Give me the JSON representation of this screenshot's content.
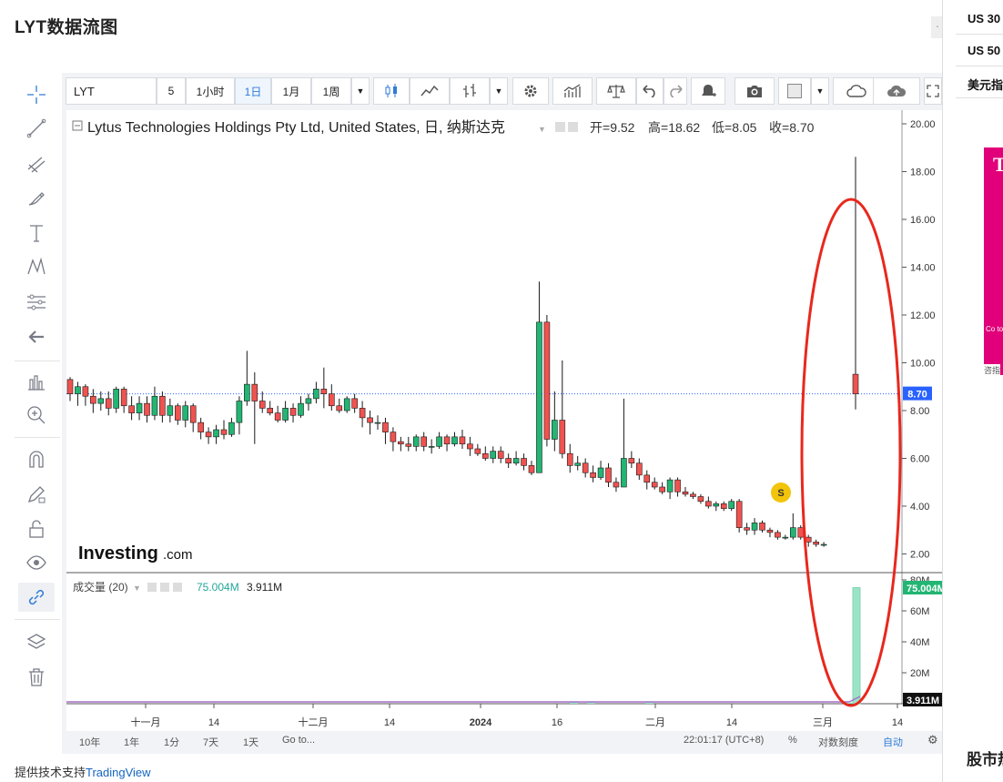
{
  "page": {
    "title": "LYT数据流图",
    "credit_prefix": "提供技术支持",
    "credit_link": "TradingView"
  },
  "right_panel": {
    "items": [
      "US 30",
      "US 50",
      "美元指"
    ],
    "ad_letter": "T",
    "ad_text": "Co to c cre am",
    "ad_tag": "咨指",
    "footer": "股市热"
  },
  "toolbar": {
    "symbol": "LYT",
    "intervals": [
      "5",
      "1小时",
      "1日",
      "1月",
      "1周"
    ],
    "active_interval": "1日",
    "icons": [
      "candles-icon",
      "area-chart-icon",
      "bars-icon",
      "settings-icon",
      "indicators-icon",
      "compare-icon",
      "undo-icon",
      "redo-icon",
      "alert-icon",
      "camera-icon",
      "color-swatch-icon",
      "cloud-icon",
      "cloud-upload-icon",
      "fullscreen-icon"
    ]
  },
  "left_tools": [
    "crosshair-icon",
    "trendline-icon",
    "pitchfork-icon",
    "brush-icon",
    "text-icon",
    "pattern-icon",
    "fib-icon",
    "back-arrow-icon",
    "measure-icon",
    "zoom-icon",
    "magnet-icon",
    "pencil-lock-icon",
    "unlock-icon",
    "eye-icon",
    "link-icon",
    "layers-icon",
    "trash-icon"
  ],
  "chart": {
    "legend_title": "Lytus Technologies Holdings Pty Ltd, United States, 日, 纳斯达克",
    "ohlc": {
      "open_label": "开=",
      "open": "9.52",
      "high_label": "高=",
      "high": "18.62",
      "low_label": "低=",
      "low": "8.05",
      "close_label": "收=",
      "close": "8.70"
    },
    "watermark": "Investing",
    "watermark_suffix": ".com",
    "last_price_label": "8.70",
    "event_marker": "S",
    "volume_legend": "成交量 (20)",
    "volume_value_1": "75.004M",
    "volume_value_2": "3.911M",
    "volume_last_label": "75.004M",
    "volume_ma_label": "3.911M",
    "timestamp": "22:01:17 (UTC+8)"
  },
  "bottom_bar": {
    "ranges": [
      "10年",
      "1年",
      "1分",
      "7天",
      "1天",
      "Go to..."
    ],
    "percent": "%",
    "log_scale": "对数刻度",
    "auto": "自动"
  },
  "chart_data": {
    "type": "candlestick",
    "price_axis": {
      "ticks": [
        "20.00",
        "18.00",
        "16.00",
        "14.00",
        "12.00",
        "10.00",
        "8.00",
        "6.00",
        "4.00",
        "2.00"
      ],
      "ylim": [
        0.7,
        20.8
      ]
    },
    "volume_axis": {
      "ticks": [
        "80M",
        "60M",
        "40M",
        "20M"
      ],
      "ylim": [
        0,
        80
      ]
    },
    "x_tick_labels": [
      "十一月",
      "14",
      "十二月",
      "14",
      "2024",
      "16",
      "二月",
      "14",
      "三月",
      "14"
    ],
    "colors": {
      "up": "#26a69a",
      "up_fill": "#22b573",
      "down": "#ef5350",
      "up_volume": "#9be3c6",
      "down_volume": "#f7b3b1",
      "annotation": "#e8281d"
    },
    "annotation": "red-ellipse-around-last-spike",
    "candles": [
      [
        9.3,
        8.7,
        9.4,
        8.4
      ],
      [
        8.7,
        9.0,
        9.2,
        8.2
      ],
      [
        9.0,
        8.6,
        9.1,
        8.2
      ],
      [
        8.6,
        8.3,
        8.9,
        7.9
      ],
      [
        8.3,
        8.5,
        8.8,
        8.0
      ],
      [
        8.5,
        8.1,
        8.8,
        7.8
      ],
      [
        8.1,
        8.9,
        9.0,
        7.9
      ],
      [
        8.9,
        8.2,
        9.0,
        7.9
      ],
      [
        8.2,
        7.9,
        8.6,
        7.6
      ],
      [
        7.9,
        8.3,
        8.6,
        7.6
      ],
      [
        8.3,
        7.8,
        8.6,
        7.5
      ],
      [
        7.8,
        8.6,
        9.0,
        7.6
      ],
      [
        8.6,
        7.8,
        8.8,
        7.5
      ],
      [
        7.8,
        8.2,
        8.5,
        7.5
      ],
      [
        8.2,
        7.6,
        8.3,
        7.4
      ],
      [
        7.6,
        8.2,
        8.4,
        7.3
      ],
      [
        8.2,
        7.5,
        8.3,
        7.1
      ],
      [
        7.5,
        7.1,
        7.7,
        6.8
      ],
      [
        7.1,
        6.9,
        7.3,
        6.6
      ],
      [
        6.9,
        7.2,
        7.4,
        6.6
      ],
      [
        7.2,
        7.0,
        7.6,
        6.8
      ],
      [
        7.0,
        7.5,
        7.7,
        6.9
      ],
      [
        7.5,
        8.4,
        8.6,
        7.0
      ],
      [
        8.4,
        9.1,
        10.5,
        8.2
      ],
      [
        9.1,
        8.4,
        9.6,
        6.6
      ],
      [
        8.4,
        8.1,
        8.8,
        7.9
      ],
      [
        8.1,
        7.9,
        8.4,
        7.8
      ],
      [
        7.9,
        7.6,
        8.2,
        7.5
      ],
      [
        7.6,
        8.1,
        8.4,
        7.5
      ],
      [
        8.1,
        7.8,
        8.3,
        7.5
      ],
      [
        7.8,
        8.3,
        8.6,
        7.7
      ],
      [
        8.3,
        8.5,
        8.7,
        8.0
      ],
      [
        8.5,
        8.9,
        9.2,
        8.3
      ],
      [
        8.9,
        8.7,
        9.8,
        8.1
      ],
      [
        8.7,
        8.2,
        9.1,
        8.0
      ],
      [
        8.2,
        8.0,
        8.5,
        7.9
      ],
      [
        8.0,
        8.5,
        8.6,
        7.9
      ],
      [
        8.5,
        8.1,
        8.7,
        7.9
      ],
      [
        8.1,
        7.7,
        8.4,
        7.3
      ],
      [
        7.7,
        7.5,
        8.0,
        7.0
      ],
      [
        7.5,
        7.5,
        7.8,
        7.2
      ],
      [
        7.5,
        7.1,
        7.7,
        6.6
      ],
      [
        7.1,
        6.7,
        7.3,
        6.3
      ],
      [
        6.7,
        6.6,
        6.9,
        6.3
      ],
      [
        6.6,
        6.5,
        6.9,
        6.3
      ],
      [
        6.5,
        6.9,
        7.0,
        6.3
      ],
      [
        6.9,
        6.5,
        7.1,
        6.3
      ],
      [
        6.5,
        6.5,
        6.8,
        6.2
      ],
      [
        6.5,
        6.9,
        7.1,
        6.4
      ],
      [
        6.9,
        6.6,
        7.0,
        6.3
      ],
      [
        6.6,
        6.9,
        7.1,
        6.5
      ],
      [
        6.9,
        6.6,
        7.2,
        6.4
      ],
      [
        6.6,
        6.4,
        6.9,
        6.1
      ],
      [
        6.4,
        6.2,
        6.6,
        6.1
      ],
      [
        6.2,
        6.0,
        6.5,
        5.9
      ],
      [
        6.0,
        6.3,
        6.5,
        5.8
      ],
      [
        6.3,
        6.0,
        6.5,
        5.8
      ],
      [
        6.0,
        5.8,
        6.2,
        5.6
      ],
      [
        5.8,
        6.0,
        6.3,
        5.7
      ],
      [
        6.0,
        5.7,
        6.2,
        5.5
      ],
      [
        5.7,
        5.4,
        5.9,
        5.3
      ],
      [
        5.4,
        11.7,
        13.4,
        5.4
      ],
      [
        11.7,
        6.8,
        12.0,
        6.5
      ],
      [
        6.8,
        7.6,
        8.8,
        6.3
      ],
      [
        7.6,
        6.2,
        10.1,
        6.0
      ],
      [
        6.2,
        5.7,
        6.6,
        5.4
      ],
      [
        5.7,
        5.8,
        6.1,
        5.5
      ],
      [
        5.8,
        5.4,
        6.0,
        5.2
      ],
      [
        5.4,
        5.2,
        5.7,
        5.0
      ],
      [
        5.2,
        5.6,
        5.9,
        5.1
      ],
      [
        5.6,
        5.0,
        5.8,
        4.8
      ],
      [
        5.0,
        4.8,
        5.2,
        4.6
      ],
      [
        4.8,
        6.0,
        8.5,
        5.8
      ],
      [
        6.0,
        5.8,
        6.3,
        5.6
      ],
      [
        5.8,
        5.3,
        6.0,
        5.1
      ],
      [
        5.3,
        5.0,
        5.5,
        4.7
      ],
      [
        5.0,
        4.8,
        5.2,
        4.7
      ],
      [
        4.8,
        4.6,
        5.0,
        4.5
      ],
      [
        4.6,
        5.1,
        5.2,
        4.3
      ],
      [
        5.1,
        4.6,
        5.2,
        4.4
      ],
      [
        4.6,
        4.5,
        4.8,
        4.4
      ],
      [
        4.5,
        4.4,
        4.6,
        4.3
      ],
      [
        4.4,
        4.2,
        4.5,
        4.1
      ],
      [
        4.2,
        4.0,
        4.4,
        3.9
      ],
      [
        4.0,
        4.1,
        4.2,
        3.8
      ],
      [
        4.1,
        3.9,
        4.2,
        3.8
      ],
      [
        3.9,
        4.2,
        4.3,
        3.8
      ],
      [
        4.2,
        3.1,
        4.3,
        2.9
      ],
      [
        3.1,
        3.0,
        3.3,
        2.8
      ],
      [
        3.0,
        3.3,
        3.5,
        2.8
      ],
      [
        3.3,
        3.0,
        3.4,
        2.9
      ],
      [
        3.0,
        2.9,
        3.1,
        2.7
      ],
      [
        2.9,
        2.7,
        3.0,
        2.6
      ],
      [
        2.7,
        2.7,
        2.8,
        2.6
      ],
      [
        2.7,
        3.1,
        3.7,
        2.6
      ],
      [
        3.1,
        2.7,
        3.2,
        2.6
      ],
      [
        2.7,
        2.5,
        2.8,
        2.3
      ],
      [
        2.5,
        2.4,
        2.6,
        2.3
      ],
      [
        2.4,
        2.4,
        2.5,
        2.3
      ],
      [
        9.52,
        8.7,
        18.62,
        8.05
      ]
    ],
    "candle_note": "each candle is [open, close, high, low] in USD; null candles mark the gap before the last bar",
    "volumes_m": [
      1.2,
      0.9,
      1.4,
      0.8,
      75.004
    ],
    "volume_note": "visible volume bars (M): small spikes near 16 and 二月, last bar 75.004M",
    "last_price": 8.7,
    "volume_ma": 3.911
  }
}
